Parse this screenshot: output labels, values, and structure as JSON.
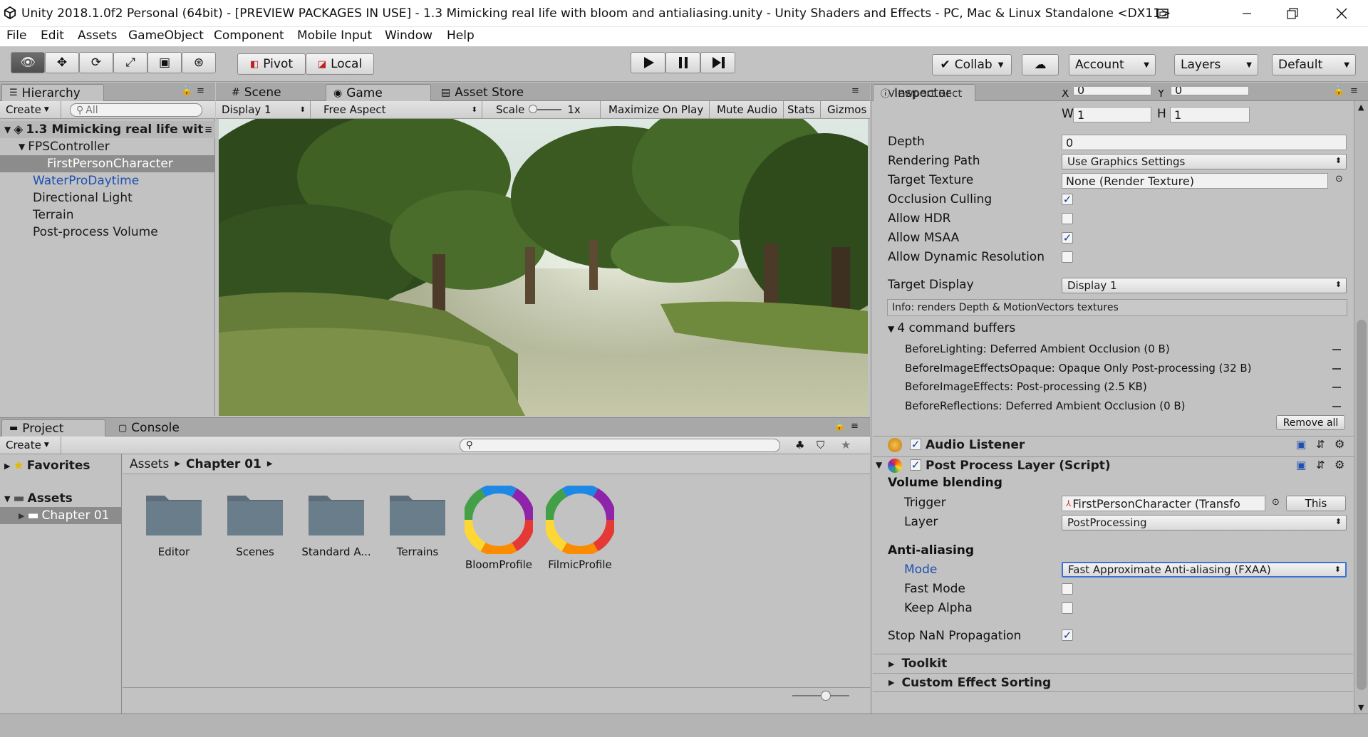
{
  "window": {
    "title": "Unity 2018.1.0f2 Personal (64bit) - [PREVIEW PACKAGES IN USE] - 1.3 Mimicking real life with bloom and antialiasing.unity - Unity Shaders and Effects - PC, Mac & Linux Standalone <DX11>"
  },
  "menu": [
    "File",
    "Edit",
    "Assets",
    "GameObject",
    "Component",
    "Mobile Input",
    "Window",
    "Help"
  ],
  "toolbar": {
    "pivot": "Pivot",
    "local": "Local",
    "collab": "Collab",
    "account": "Account",
    "layers": "Layers",
    "layout": "Default"
  },
  "hierarchy": {
    "tab": "Hierarchy",
    "create": "Create",
    "search_placeholder": "All",
    "scene": "1.3 Mimicking real life wit",
    "items": [
      "FPSController",
      "FirstPersonCharacter",
      "WaterProDaytime",
      "Directional Light",
      "Terrain",
      "Post-process Volume"
    ]
  },
  "center_tabs": {
    "scene": "Scene",
    "game": "Game",
    "store": "Asset Store"
  },
  "game_bar": {
    "display": "Display 1",
    "aspect": "Free Aspect",
    "scale_label": "Scale",
    "scale_value": "1x",
    "maximize": "Maximize On Play",
    "mute": "Mute Audio",
    "stats": "Stats",
    "gizmos": "Gizmos"
  },
  "project": {
    "tab": "Project",
    "console": "Console",
    "create": "Create",
    "favorites": "Favorites",
    "assets": "Assets",
    "chapter": "Chapter 01",
    "breadcrumb": [
      "Assets",
      "Chapter 01"
    ],
    "items": [
      "Editor",
      "Scenes",
      "Standard A...",
      "Terrains",
      "BloomProfile",
      "FilmicProfile"
    ]
  },
  "inspector": {
    "tab": "Inspector",
    "viewport_label": "Viewport Rect",
    "x_label": "X",
    "x_value": "0",
    "y_label": "Y",
    "y_value": "0",
    "w_label": "W",
    "w_value": "1",
    "h_label": "H",
    "h_value": "1",
    "rows": [
      {
        "label": "Depth",
        "value": "0"
      },
      {
        "label": "Rendering Path",
        "value": "Use Graphics Settings"
      },
      {
        "label": "Target Texture",
        "value": "None (Render Texture)"
      },
      {
        "label": "Occlusion Culling",
        "checked": true
      },
      {
        "label": "Allow HDR",
        "checked": false
      },
      {
        "label": "Allow MSAA",
        "checked": true
      },
      {
        "label": "Allow Dynamic Resolution",
        "checked": false
      },
      {
        "label": "Target Display",
        "value": "Display 1"
      }
    ],
    "info": "Info: renders Depth & MotionVectors textures",
    "cmd_title": "4 command buffers",
    "commands": [
      "BeforeLighting: Deferred Ambient Occlusion (0 B)",
      "BeforeImageEffectsOpaque: Opaque Only Post-processing (32 B)",
      "BeforeImageEffects: Post-processing (2.5 KB)",
      "BeforeReflections: Deferred Ambient Occlusion (0 B)"
    ],
    "remove_all": "Remove all",
    "audio_listener": "Audio Listener",
    "ppl": "Post Process Layer (Script)",
    "volume_blending": "Volume blending",
    "trigger_label": "Trigger",
    "trigger_value": "FirstPersonCharacter (Transfo",
    "this": "This",
    "layer_label": "Layer",
    "layer_value": "PostProcessing",
    "aa": "Anti-aliasing",
    "mode_label": "Mode",
    "mode_value": "Fast Approximate Anti-aliasing (FXAA)",
    "fast_mode": "Fast Mode",
    "keep_alpha": "Keep Alpha",
    "stop_nan": "Stop NaN Propagation",
    "toolkit": "Toolkit",
    "custom_sorting": "Custom Effect Sorting"
  },
  "colors": {
    "accent_blue": "#1f4fb0",
    "selected": "#8c8c8c"
  }
}
